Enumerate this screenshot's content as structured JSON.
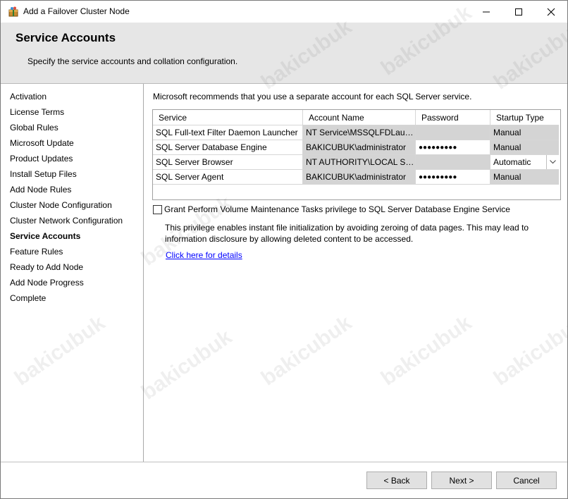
{
  "window": {
    "title": "Add a Failover Cluster Node"
  },
  "header": {
    "title": "Service Accounts",
    "subtitle": "Specify the service accounts and collation configuration."
  },
  "nav": {
    "items": [
      "Activation",
      "License Terms",
      "Global Rules",
      "Microsoft Update",
      "Product Updates",
      "Install Setup Files",
      "Add Node Rules",
      "Cluster Node Configuration",
      "Cluster Network Configuration",
      "Service Accounts",
      "Feature Rules",
      "Ready to Add Node",
      "Add Node Progress",
      "Complete"
    ],
    "current": "Service Accounts"
  },
  "content": {
    "intro": "Microsoft recommends that you use a separate account for each SQL Server service.",
    "table": {
      "headers": [
        "Service",
        "Account Name",
        "Password",
        "Startup Type"
      ],
      "rows": [
        {
          "service": "SQL Full-text Filter Daemon Launcher",
          "account": "NT Service\\MSSQLFDLaun...",
          "password": "",
          "startup": "Manual"
        },
        {
          "service": "SQL Server Database Engine",
          "account": "BAKICUBUK\\administrator",
          "password": "●●●●●●●●●",
          "startup": "Manual"
        },
        {
          "service": "SQL Server Browser",
          "account": "NT AUTHORITY\\LOCAL SE...",
          "password": "",
          "startup": "Automatic"
        },
        {
          "service": "SQL Server Agent",
          "account": "BAKICUBUK\\administrator",
          "password": "●●●●●●●●●",
          "startup": "Manual"
        }
      ]
    },
    "checkbox_label": "Grant Perform Volume Maintenance Tasks privilege to SQL Server Database Engine Service",
    "checkbox_checked": false,
    "description": "This privilege enables instant file initialization by avoiding zeroing of data pages. This may lead to information disclosure by allowing deleted content to be accessed.",
    "details_link": "Click here for details"
  },
  "footer": {
    "back": "< Back",
    "next": "Next >",
    "cancel": "Cancel"
  },
  "watermark": "bakicubuk",
  "colors": {
    "header_bg": "#e6e6e6",
    "link": "#0000ff",
    "grey_cell": "#d4d4d4"
  }
}
